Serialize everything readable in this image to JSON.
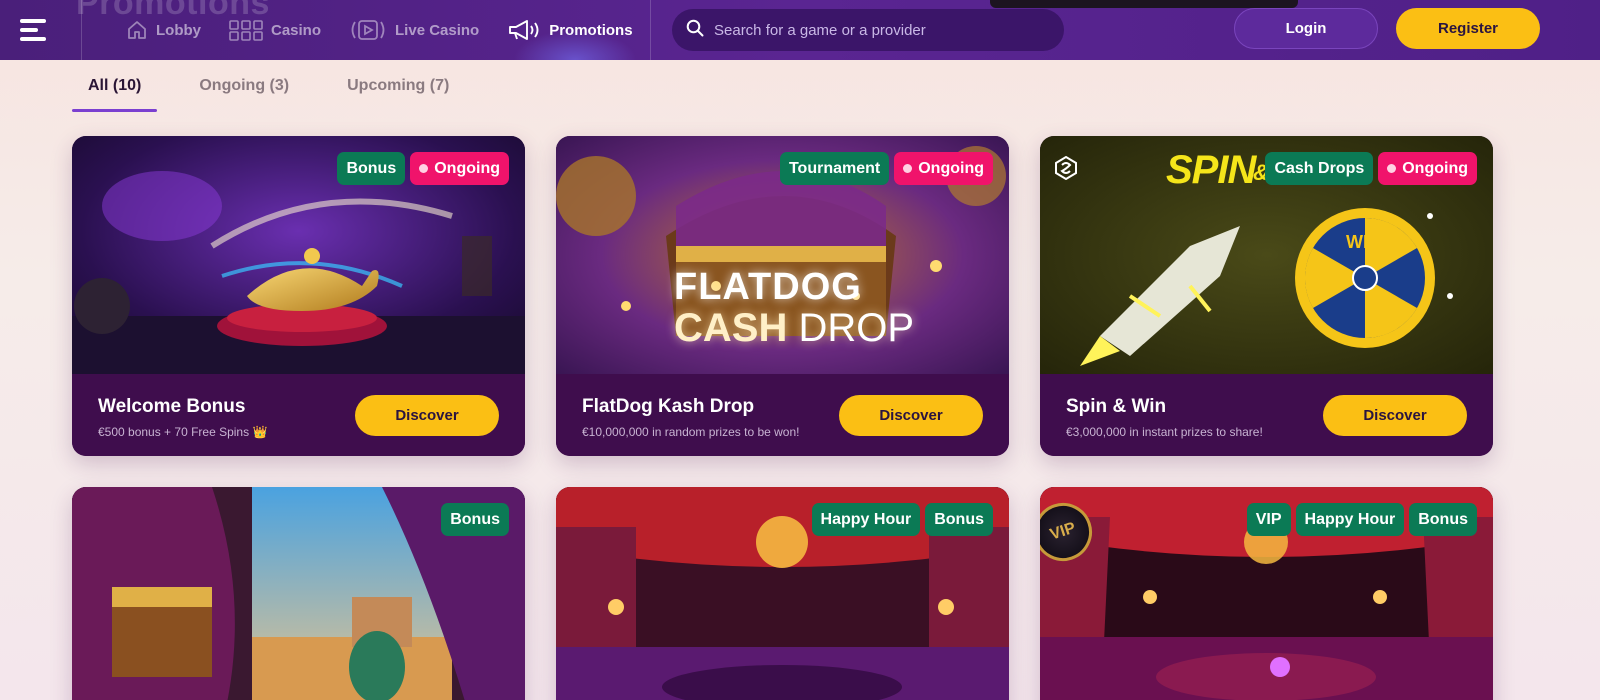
{
  "header": {
    "ghost_title": "Promotions",
    "nav": [
      {
        "label": "Lobby",
        "icon": "home-icon"
      },
      {
        "label": "Casino",
        "icon": "grid-icon"
      },
      {
        "label": "Live Casino",
        "icon": "play-icon"
      },
      {
        "label": "Promotions",
        "icon": "megaphone-icon",
        "active": true
      }
    ],
    "search_placeholder": "Search for a game or a provider",
    "login_label": "Login",
    "register_label": "Register"
  },
  "tabs": [
    {
      "label": "All (10)",
      "active": true
    },
    {
      "label": "Ongoing (3)"
    },
    {
      "label": "Upcoming (7)"
    }
  ],
  "cards": [
    {
      "title": "Welcome Bonus",
      "subtitle": "€500 bonus + 70 Free Spins 👑",
      "button": "Discover",
      "badges": [
        "Bonus"
      ],
      "status": "Ongoing"
    },
    {
      "title": "FlatDog Kash Drop",
      "subtitle": "€10,000,000 in random prizes to be won!",
      "button": "Discover",
      "badges": [
        "Tournament"
      ],
      "status": "Ongoing",
      "art_line1": "FLATDOG",
      "art_line2_a": "CASH",
      "art_line2_b": " DROP"
    },
    {
      "title": "Spin & Win",
      "subtitle": "€3,000,000 in instant prizes to share!",
      "button": "Discover",
      "badges": [
        "Cash Drops"
      ],
      "status": "Ongoing",
      "art_title": "SPIN",
      "art_amp": "&",
      "art_wheel": "WIN"
    },
    {
      "badges": [
        "Bonus"
      ]
    },
    {
      "badges": [
        "Happy Hour",
        "Bonus"
      ]
    },
    {
      "badges": [
        "VIP",
        "Happy Hour",
        "Bonus"
      ],
      "seal": "VIP"
    }
  ],
  "colors": {
    "header_bg": "#4a1f7a",
    "accent_yellow": "#fbbf14",
    "badge_green": "#0b7a55",
    "badge_pink": "#f0136b",
    "card_footer": "#3f0d4d"
  }
}
